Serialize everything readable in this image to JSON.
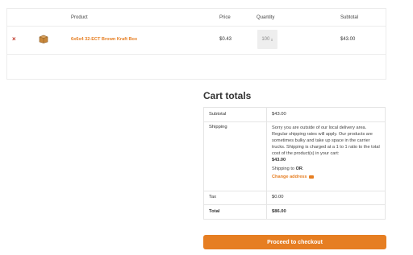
{
  "cart": {
    "headers": {
      "product": "Product",
      "price": "Price",
      "quantity": "Quantity",
      "subtotal": "Subtotal"
    },
    "remove_icon": "×",
    "item": {
      "name": "6x6x4 32-ECT Brown Kraft Box",
      "price": "$0.43",
      "quantity": "100",
      "subtotal": "$43.00",
      "thumbnail_icon": "box-thumbnail"
    }
  },
  "totals": {
    "title": "Cart totals",
    "subtotal_label": "Subtotal",
    "subtotal_value": "$43.00",
    "shipping_label": "Shipping",
    "shipping_message": "Sorry you are outside of our local delivery area. Regular shipping rates will apply. Our products are sometimes bulky and take up space in the carrier trucks. Shipping is charged at a 1 to 1 ratio to the total cost of the product(s) in your cart:",
    "shipping_amount": "$43.00",
    "shipping_to_prefix": "Shipping to",
    "shipping_to_state": "OR",
    "shipping_to_suffix": ".",
    "change_address": "Change address",
    "tax_label": "Tax",
    "tax_value": "$0.00",
    "total_label": "Total",
    "total_value": "$86.00"
  },
  "checkout_button": "Proceed to checkout",
  "colors": {
    "accent": "#e67e22",
    "remove": "#c0392b"
  }
}
